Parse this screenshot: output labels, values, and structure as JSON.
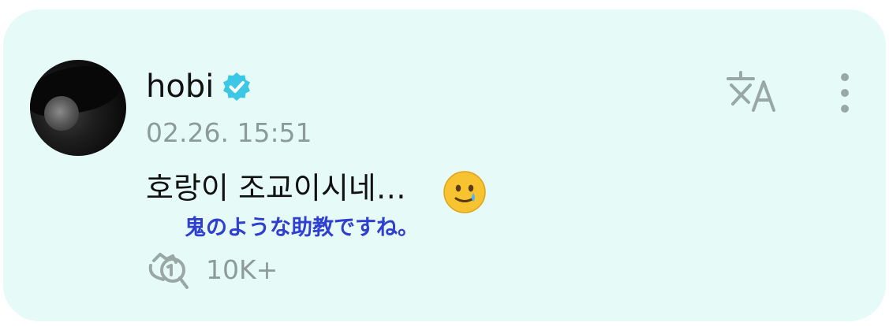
{
  "post": {
    "username": "hobi",
    "verified": true,
    "timestamp": "02.26. 15:51",
    "text": "호랑이 조교이시네…",
    "emoji": "smiling-face-with-tear",
    "translation": "鬼のような助教ですね。",
    "reaction_count": "10K+"
  },
  "icons": {
    "translate": "translate-icon",
    "more": "more-vertical-icon",
    "reaction": "reaction-bubble-icon",
    "verified": "verified-badge-icon"
  },
  "colors": {
    "card_background": "#e6fbf7",
    "verified_badge": "#3cc7e6",
    "muted_text": "#8d9b98",
    "translation_text": "#2f3fd2"
  }
}
